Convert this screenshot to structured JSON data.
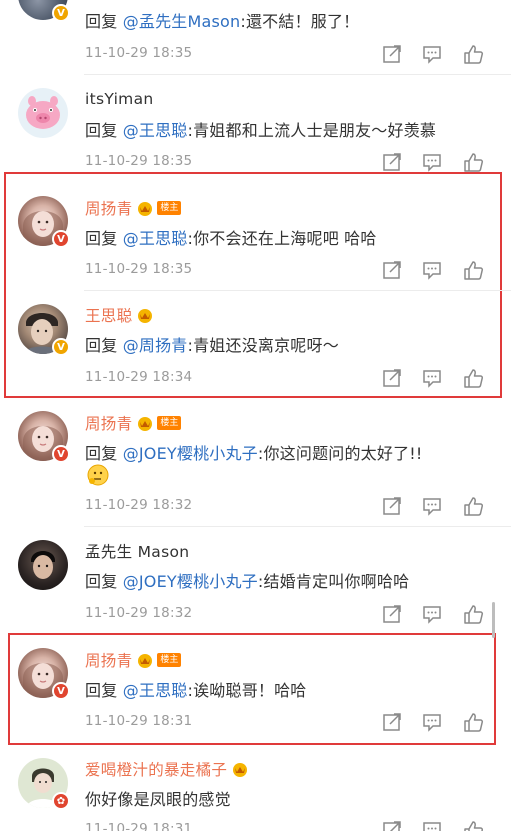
{
  "comments": [
    {
      "author": "",
      "mention": "@孟先生Mason",
      "prefix": "回复 ",
      "text": ":還不結！服了！",
      "time": "11-10-29 18:35"
    },
    {
      "author": "itsYiman",
      "mention": "@王思聪",
      "prefix": "回复 ",
      "text": ":青姐都和上流人士是朋友～好羡慕",
      "time": "11-10-29 18:35"
    },
    {
      "author": "周扬青",
      "tag": "楼主",
      "mention": "@王思聪",
      "prefix": "回复 ",
      "text": ":你不会还在上海呢吧 哈哈",
      "time": "11-10-29 18:35"
    },
    {
      "author": "王思聪",
      "mention": "@周扬青",
      "prefix": "回复 ",
      "text": ":青姐还没离京呢呀～",
      "time": "11-10-29 18:34"
    },
    {
      "author": "周扬青",
      "tag": "楼主",
      "mention": "@JOEY樱桃小丸子",
      "prefix": "回复 ",
      "text": ":你这问题问的太好了!!",
      "time": "11-10-29 18:32"
    },
    {
      "author": "孟先生 Mason",
      "mention": "@JOEY樱桃小丸子",
      "prefix": "回复 ",
      "text": ":结婚肯定叫你啊哈哈",
      "time": "11-10-29 18:32"
    },
    {
      "author": "周扬青",
      "tag": "楼主",
      "mention": "@王思聪",
      "prefix": "回复 ",
      "text": ":诶呦聪哥！哈哈",
      "time": "11-10-29 18:31"
    },
    {
      "author": "爱喝橙汁的暴走橘子",
      "text": "你好像是凤眼的感觉",
      "time": "11-10-29 18:31"
    }
  ],
  "icons": {
    "forward": "forward-icon",
    "comment": "comment-icon",
    "like": "thumbs-up-icon",
    "crown": "crown-badge-icon",
    "verified": "verified-v-icon"
  },
  "colors": {
    "author_orange": "#eb7350",
    "mention_blue": "#2f6fc1",
    "highlight_red": "#e03a3a",
    "meta_gray": "#9b9b9b"
  }
}
